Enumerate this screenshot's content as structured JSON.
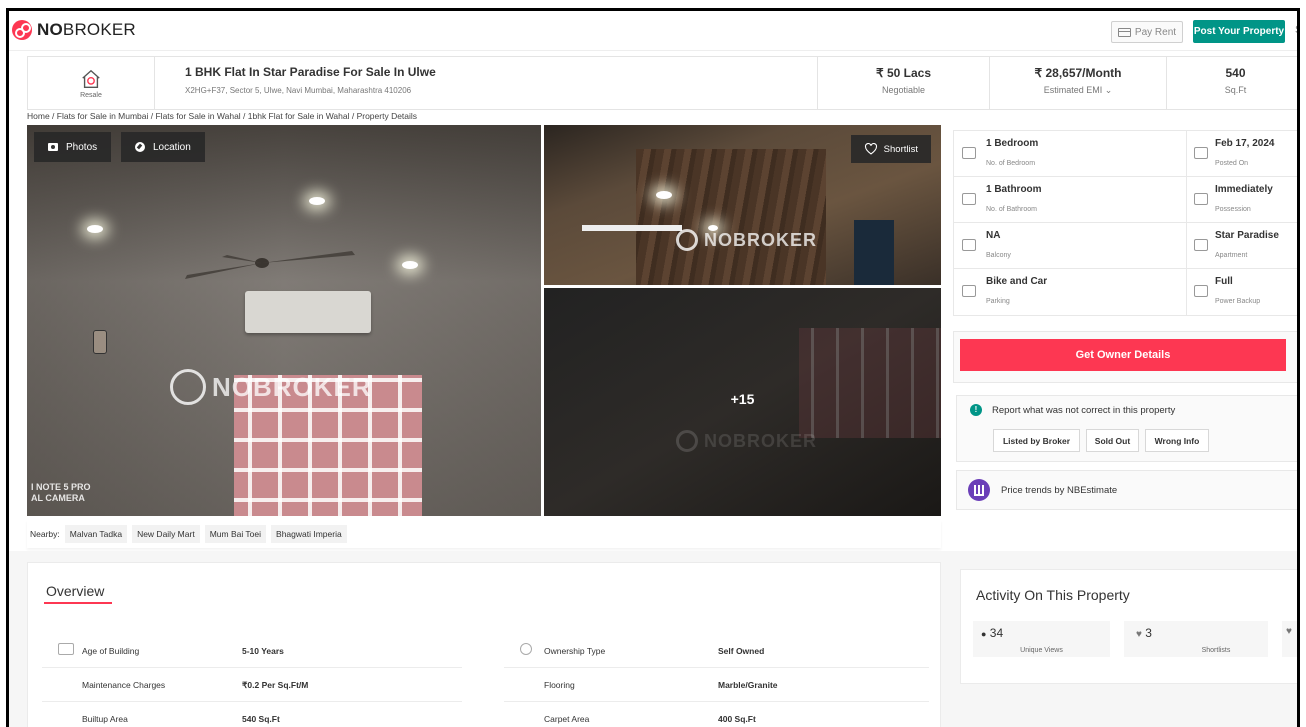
{
  "nav": {
    "logo_bold": "NO",
    "logo_rest": "BROKER",
    "pay_rent": "Pay Rent",
    "post_property": "Post Your Property",
    "overflow_letter": "S"
  },
  "property": {
    "badge": "Resale",
    "title": "1 BHK Flat In Star Paradise For Sale In Ulwe",
    "address": "X2HG+F37, Sector 5, Ulwe, Navi Mumbai, Maharashtra 410206",
    "price": "₹ 50 Lacs",
    "price_label": "Negotiable",
    "emi": "₹ 28,657/Month",
    "emi_label": "Estimated EMI ⌄",
    "area": "540",
    "area_label": "Sq.Ft"
  },
  "breadcrumb": "Home / Flats for Sale in Mumbai / Flats for Sale in Wahal / 1bhk Flat for Sale in Wahal / Property Details",
  "gallery": {
    "photos_btn": "Photos",
    "location_btn": "Location",
    "shortlist_btn": "Shortlist",
    "more_count": "+15",
    "watermark": "NOBROKER",
    "camera_line1": "I NOTE 5 PRO",
    "camera_line2": "AL CAMERA"
  },
  "details": [
    {
      "value": "1 Bedroom",
      "label": "No. of Bedroom",
      "icon": "bed-icon"
    },
    {
      "value": "Feb 17, 2024",
      "label": "Posted On",
      "icon": "calendar-icon"
    },
    {
      "value": "1 Bathroom",
      "label": "No. of Bathroom",
      "icon": "bathtub-icon"
    },
    {
      "value": "Immediately",
      "label": "Possession",
      "icon": "key-icon"
    },
    {
      "value": "NA",
      "label": "Balcony",
      "icon": "balcony-icon"
    },
    {
      "value": "Star Paradise",
      "label": "Apartment",
      "icon": "building-icon"
    },
    {
      "value": "Bike and Car",
      "label": "Parking",
      "icon": "car-icon"
    },
    {
      "value": "Full",
      "label": "Power Backup",
      "icon": "battery-icon"
    }
  ],
  "owner_btn": "Get Owner Details",
  "report": {
    "text": "Report what was not correct in this property",
    "buttons": [
      "Listed by Broker",
      "Sold Out",
      "Wrong Info"
    ]
  },
  "trends": "Price trends by NBEstimate",
  "nearby": {
    "label": "Nearby:",
    "places": [
      "Malvan Tadka",
      "New Daily Mart",
      "Mum Bai Toei",
      "Bhagwati Imperia"
    ]
  },
  "overview": {
    "title": "Overview",
    "rows": [
      {
        "key": "Age of Building",
        "value": "5-10 Years"
      },
      {
        "key": "Ownership Type",
        "value": "Self Owned"
      },
      {
        "key": "Maintenance Charges",
        "value": "₹0.2 Per Sq.Ft/M"
      },
      {
        "key": "Flooring",
        "value": "Marble/Granite"
      },
      {
        "key": "Builtup Area",
        "value": "540 Sq.Ft"
      },
      {
        "key": "Carpet Area",
        "value": "400 Sq.Ft"
      }
    ]
  },
  "activity": {
    "title": "Activity On This Property",
    "views": "34",
    "views_label": "Unique Views",
    "shortlists": "3",
    "shortlists_label": "Shortlists"
  },
  "colors": {
    "brand_red": "#fd3752",
    "brand_teal": "#009587",
    "trend_purple": "#6b3fb8"
  }
}
